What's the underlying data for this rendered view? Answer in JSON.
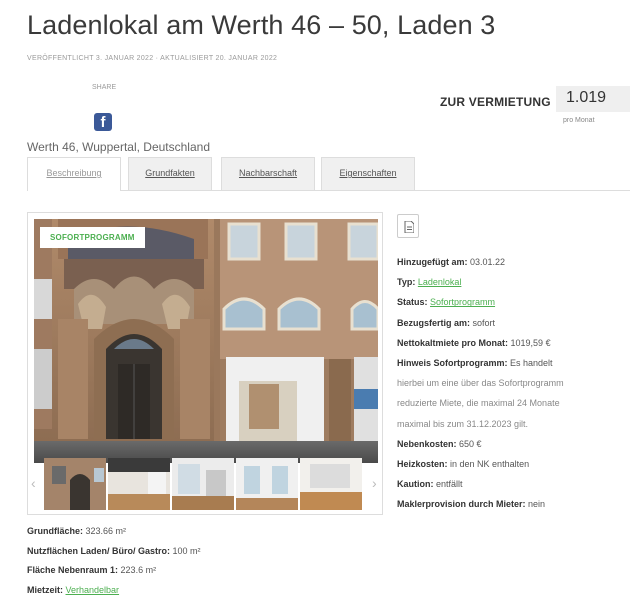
{
  "page": {
    "title": "Ladenlokal am Werth 46 – 50, Laden 3",
    "meta": "VERÖFFENTLICHT 3. JANUAR 2022 · AKTUALISIERT 20. JANUAR 2022",
    "share_label": "SHARE",
    "facebook_glyph": "f",
    "location": "Werth 46, Wuppertal, Deutschland"
  },
  "rent": {
    "label": "ZUR VERMIETUNG",
    "price": "1.019",
    "per_month": "pro Monat"
  },
  "tabs": [
    {
      "label": "Beschreibung",
      "active": true
    },
    {
      "label": "Grundfakten",
      "active": false
    },
    {
      "label": "Nachbarschaft",
      "active": false
    },
    {
      "label": "Eigenschaften",
      "active": false
    }
  ],
  "gallery": {
    "badge": "SOFORTPROGRAMM",
    "prev_arrow": "‹",
    "next_arrow": "›"
  },
  "facts": [
    {
      "label": "Hinzugefügt am:",
      "value": "03.01.22",
      "link": false
    },
    {
      "label": "Typ:",
      "value": "Ladenlokal",
      "link": true
    },
    {
      "label": "Status:",
      "value": "Sofortprogramm",
      "link": true
    },
    {
      "label": "Bezugsfertig am:",
      "value": "sofort",
      "link": false
    },
    {
      "label": "Nettokaltmiete pro Monat:",
      "value": "1019,59 €",
      "link": false
    },
    {
      "label": "Hinweis Sofortprogramm:",
      "value": "Es handelt",
      "link": false
    },
    {
      "label": "",
      "value": "hierbei um eine über das Sofortprogramm",
      "link": false
    },
    {
      "label": "",
      "value": "reduzierte Miete, die maximal 24 Monate",
      "link": false
    },
    {
      "label": "",
      "value": "maximal bis zum 31.12.2023 gilt.",
      "link": false
    },
    {
      "label": "Nebenkosten:",
      "value": "650 €",
      "link": false
    },
    {
      "label": "Heizkosten:",
      "value": "in den NK enthalten",
      "link": false
    },
    {
      "label": "Kaution:",
      "value": "entfällt",
      "link": false
    },
    {
      "label": "Maklerprovision durch Mieter:",
      "value": "nein",
      "link": false
    }
  ],
  "bottom_facts": [
    {
      "label": "Grundfläche:",
      "value": "323.66 m²",
      "link": false
    },
    {
      "label": "Nutzflächen Laden/ Büro/ Gastro:",
      "value": "100 m²",
      "link": false
    },
    {
      "label": "Fläche Nebenraum 1:",
      "value": "223.6 m²",
      "link": false
    },
    {
      "label": "Mietzeit:",
      "value": "Verhandelbar",
      "link": true
    }
  ],
  "colors": {
    "accent_green": "#4caf50",
    "facebook_blue": "#3b5998",
    "price_box": "#efefef"
  }
}
